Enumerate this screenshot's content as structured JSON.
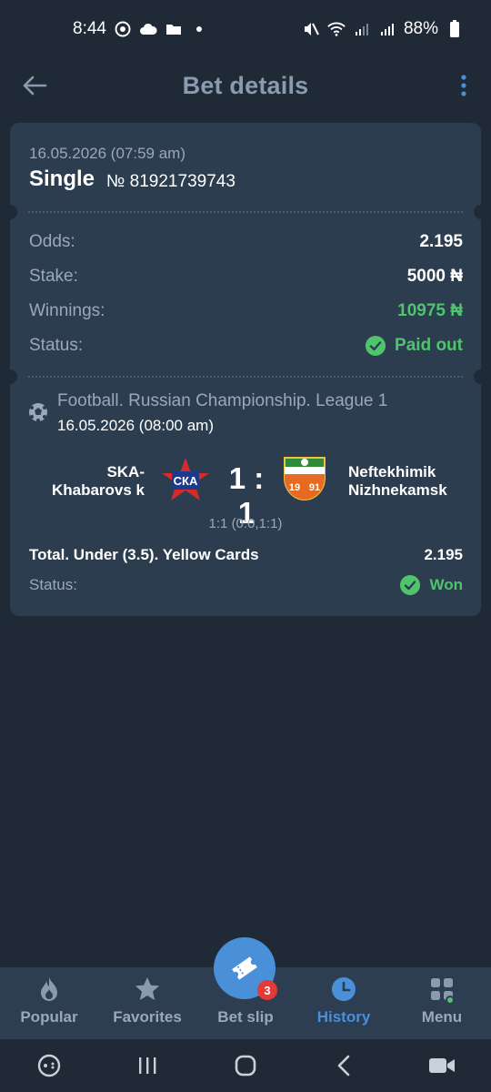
{
  "status_bar": {
    "time": "8:44",
    "battery": "88%"
  },
  "header": {
    "title": "Bet details"
  },
  "bet": {
    "date": "16.05.2026 (07:59 am)",
    "type": "Single",
    "number": "№ 81921739743",
    "odds_label": "Odds:",
    "odds_value": "2.195",
    "stake_label": "Stake:",
    "stake_value": "5000 ₦",
    "winnings_label": "Winnings:",
    "winnings_value": "10975 ₦",
    "status_label": "Status:",
    "status_value": "Paid out"
  },
  "event": {
    "title": "Football. Russian Championship. League 1",
    "date": "16.05.2026 (08:00 am)",
    "home_team": "SKA-Khabarovs k",
    "away_team": "Neftekhimik Nizhnekamsk",
    "score": "1 : 1",
    "score_detail": "1:1 (0:0,1:1)",
    "market": "Total. Under (3.5). Yellow Cards",
    "market_odds": "2.195",
    "status_label": "Status:",
    "status_value": "Won"
  },
  "nav": {
    "items": [
      {
        "label": "Popular",
        "icon": "flame-icon"
      },
      {
        "label": "Favorites",
        "icon": "star-icon"
      },
      {
        "label": "Bet slip",
        "icon": "ticket-icon"
      },
      {
        "label": "History",
        "icon": "clock-icon"
      },
      {
        "label": "Menu",
        "icon": "grid-icon"
      }
    ],
    "active": "History",
    "betslip_count": "3"
  },
  "colors": {
    "accent": "#4a90d9",
    "success": "#4ec56b",
    "card": "#2d3d50",
    "background": "#1f2a36"
  }
}
